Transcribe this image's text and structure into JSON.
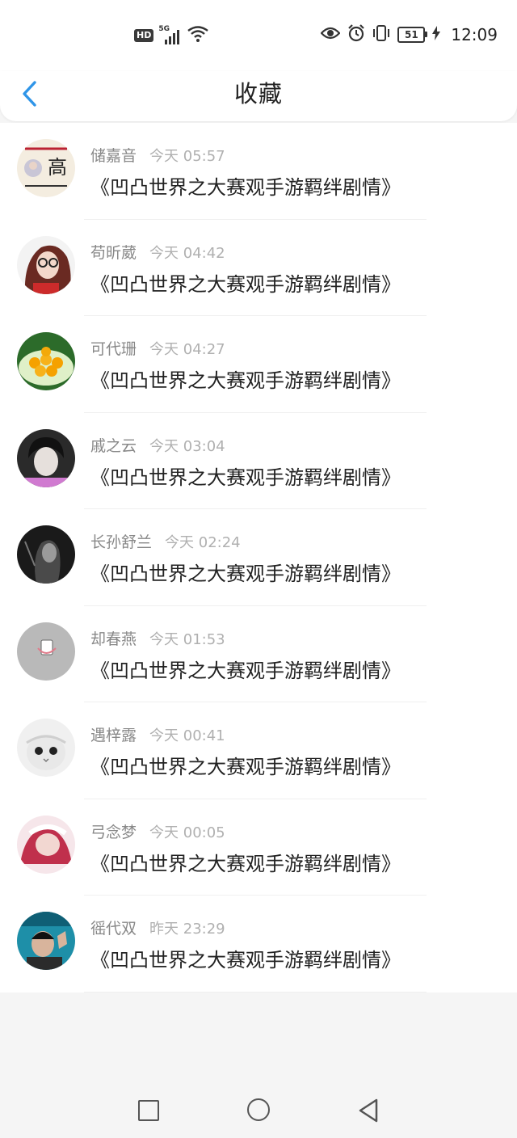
{
  "status_bar": {
    "hd_label": "HD",
    "network_label": "5G",
    "battery_level": "51",
    "time": "12:09",
    "icons": [
      "hd-icon",
      "signal-icon",
      "wifi-icon",
      "eye-icon",
      "alarm-icon",
      "vibrate-icon",
      "battery-icon",
      "charging-icon"
    ]
  },
  "header": {
    "title": "收藏",
    "back_icon": "chevron-left-icon",
    "accent_color": "#2f95e8"
  },
  "favorites": [
    {
      "name": "储嘉音",
      "date": "今天 05:57",
      "title": "《凹凸世界之大赛观手游羁绊剧情》"
    },
    {
      "name": "苟昕葳",
      "date": "今天 04:42",
      "title": "《凹凸世界之大赛观手游羁绊剧情》"
    },
    {
      "name": "可代珊",
      "date": "今天 04:27",
      "title": "《凹凸世界之大赛观手游羁绊剧情》"
    },
    {
      "name": "戚之云",
      "date": "今天 03:04",
      "title": "《凹凸世界之大赛观手游羁绊剧情》"
    },
    {
      "name": "长孙舒兰",
      "date": "今天 02:24",
      "title": "《凹凸世界之大赛观手游羁绊剧情》"
    },
    {
      "name": "却春燕",
      "date": "今天 01:53",
      "title": "《凹凸世界之大赛观手游羁绊剧情》"
    },
    {
      "name": "遇梓露",
      "date": "今天 00:41",
      "title": "《凹凸世界之大赛观手游羁绊剧情》"
    },
    {
      "name": "弓念梦",
      "date": "今天 00:05",
      "title": "《凹凸世界之大赛观手游羁绊剧情》"
    },
    {
      "name": "徭代双",
      "date": "昨天 23:29",
      "title": "《凹凸世界之大赛观手游羁绊剧情》"
    }
  ],
  "avatar_avatar_text": "高",
  "bottom_nav": {
    "icons": [
      "recent-apps-square-icon",
      "home-circle-icon",
      "back-triangle-icon"
    ]
  }
}
